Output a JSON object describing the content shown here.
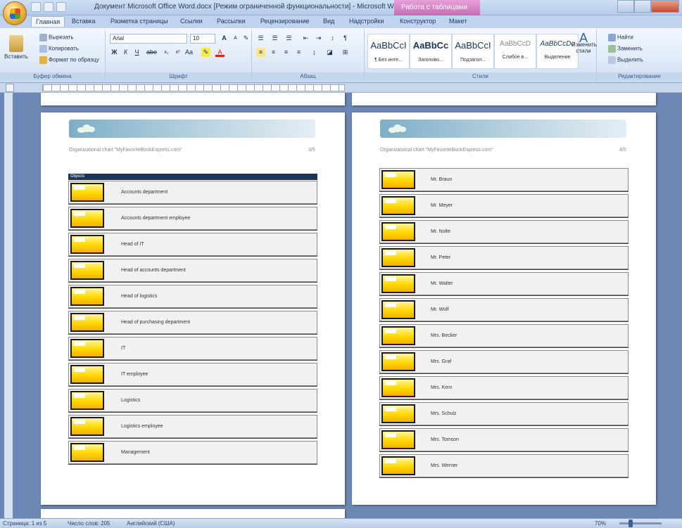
{
  "window": {
    "title": "Документ Microsoft Office Word.docx [Режим ограниченной функциональности] - Microsoft Word",
    "context_tab": "Работа с таблицами"
  },
  "ribbon_tabs": [
    "Главная",
    "Вставка",
    "Разметка страницы",
    "Ссылки",
    "Рассылки",
    "Рецензирование",
    "Вид",
    "Надстройки",
    "Конструктор",
    "Макет"
  ],
  "clipboard": {
    "paste": "Вставить",
    "cut": "Вырезать",
    "copy": "Копировать",
    "format_painter": "Формат по образцу",
    "label": "Буфер обмена"
  },
  "font": {
    "name": "Arial",
    "size": "10",
    "label": "Шрифт"
  },
  "paragraph": {
    "label": "Абзац"
  },
  "styles": {
    "items": [
      {
        "sample": "AaBbCcI",
        "name": "¶ Без инте..."
      },
      {
        "sample": "AaBbCc",
        "name": "Заголово..."
      },
      {
        "sample": "AaBbCcI",
        "name": "Подзагол..."
      },
      {
        "sample": "AaBbCcD",
        "name": "Слабое в..."
      },
      {
        "sample": "AaBbCcDc",
        "name": "Выделение"
      }
    ],
    "change": "Изменить стили",
    "label": "Стили"
  },
  "editing": {
    "find": "Найти",
    "replace": "Заменить",
    "select": "Выделить",
    "label": "Редактирование"
  },
  "page_left": {
    "caption": "Organizational chart \"MyFavoriteBookExpress.com\"",
    "number": "3/5",
    "section": "Objects",
    "items": [
      "Accounts department",
      "Accounts department employee",
      "Head of IT",
      "Head of accounts department",
      "Head of logistics",
      "Head of purchasing department",
      "IT",
      "IT employee",
      "Logistics",
      "Logistics employee",
      "Management"
    ]
  },
  "page_right": {
    "caption": "Organizational chart \"MyFavoriteBookExpress.com\"",
    "number": "4/5",
    "items": [
      "Mr. Braun",
      "Mr. Meyer",
      "Mr. Nolte",
      "Mr. Peter",
      "Mr. Walter",
      "Mr. Wolf",
      "Mrs. Becker",
      "Mrs. Graf",
      "Mrs. Kern",
      "Mrs. Schulz",
      "Mrs. Tomson",
      "Mrs. Werner"
    ]
  },
  "status": {
    "page": "Страница: 1 из 5",
    "words": "Число слов: 205",
    "language": "Английский (США)",
    "zoom": "70%"
  }
}
